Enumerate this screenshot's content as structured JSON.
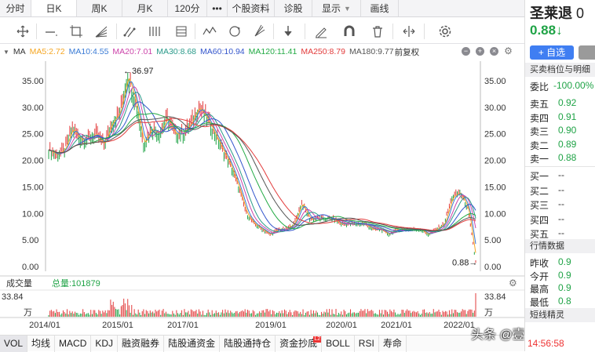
{
  "tabs": [
    {
      "label": "分时",
      "w": 40
    },
    {
      "label": "日K",
      "w": 58,
      "active": true
    },
    {
      "label": "周K",
      "w": 58
    },
    {
      "label": "月K",
      "w": 58
    },
    {
      "label": "120分",
      "w": 50
    },
    {
      "label": "•••",
      "w": 26
    },
    {
      "label": "个股资料",
      "w": 60
    },
    {
      "label": "诊股",
      "w": 48
    },
    {
      "label": "显示",
      "w": 62,
      "more": true
    },
    {
      "label": "画线",
      "w": 48
    }
  ],
  "ma_bar": {
    "name": "MA",
    "items": [
      {
        "text": "MA5:2.72",
        "color": "#f5a623"
      },
      {
        "text": "MA10:4.55",
        "color": "#3a7bd5"
      },
      {
        "text": "MA20:7.01",
        "color": "#cc44aa"
      },
      {
        "text": "MA30:8.68",
        "color": "#2a9a8a"
      },
      {
        "text": "MA60:10.94",
        "color": "#3355cc"
      },
      {
        "text": "MA120:11.41",
        "color": "#22aa44"
      },
      {
        "text": "MA250:8.79",
        "color": "#e23b3b"
      },
      {
        "text": "MA180:9.77",
        "color": "#555555"
      }
    ],
    "adjust": "前复权"
  },
  "chart_data": {
    "type": "candlestick",
    "y_ticks": [
      "35.00",
      "30.00",
      "25.00",
      "20.00",
      "15.00",
      "10.00",
      "5.00",
      "0.00"
    ],
    "x_labels": [
      "2014/01",
      "2015/01",
      "2017/01",
      "2019/01",
      "2020/01",
      "2021/01",
      "2022/01"
    ],
    "high_label": "←36.97",
    "low_label": "0.88→",
    "approx_close_series": [
      22,
      21,
      22,
      26,
      24,
      24,
      25,
      23,
      27,
      29,
      36,
      31,
      23,
      26,
      25,
      28,
      25,
      25,
      27,
      30,
      28,
      25,
      22,
      19,
      15,
      10,
      8,
      7,
      6,
      7,
      7,
      8,
      12,
      9,
      9,
      9,
      9,
      8,
      8,
      8,
      8,
      7,
      7,
      6,
      7,
      7,
      7,
      7,
      6,
      7,
      8,
      13,
      14,
      11,
      0.88
    ],
    "volume_label": "成交量",
    "volume_total": "总量:101879",
    "volume_max": "33.84",
    "volume_unit": "万"
  },
  "side": {
    "name": "圣莱退",
    "code": "0",
    "price": "0.88",
    "arrow": "↓",
    "add_label": "+ 自选",
    "orderbook_title": "买卖档位与明细",
    "weibi_label": "委比",
    "weibi_value": "-100.00%",
    "asks": [
      {
        "l": "卖五",
        "v": "0.92"
      },
      {
        "l": "卖四",
        "v": "0.91"
      },
      {
        "l": "卖三",
        "v": "0.90"
      },
      {
        "l": "卖二",
        "v": "0.89"
      },
      {
        "l": "卖一",
        "v": "0.88"
      }
    ],
    "bids": [
      {
        "l": "买一",
        "v": "--"
      },
      {
        "l": "买二",
        "v": "--"
      },
      {
        "l": "买三",
        "v": "--"
      },
      {
        "l": "买四",
        "v": "--"
      },
      {
        "l": "买五",
        "v": "--"
      }
    ],
    "market_title": "行情数据",
    "market": [
      {
        "l": "昨收",
        "v": "0.9"
      },
      {
        "l": "今开",
        "v": "0.9"
      },
      {
        "l": "最高",
        "v": "0.9"
      },
      {
        "l": "最低",
        "v": "0.8"
      }
    ],
    "short_title": "短线精灵",
    "time": "14:56:58"
  },
  "bottom_tabs": [
    {
      "label": "VOL",
      "active": true
    },
    {
      "label": "均线"
    },
    {
      "label": "MACD"
    },
    {
      "label": "KDJ"
    },
    {
      "label": "融资融券"
    },
    {
      "label": "陆股通资金"
    },
    {
      "label": "陆股通持仓"
    },
    {
      "label": "资金抄底",
      "badge": "L2"
    },
    {
      "label": "BOLL"
    },
    {
      "label": "RSI"
    },
    {
      "label": "寿命"
    }
  ],
  "watermark": "头条 @壹号股权"
}
